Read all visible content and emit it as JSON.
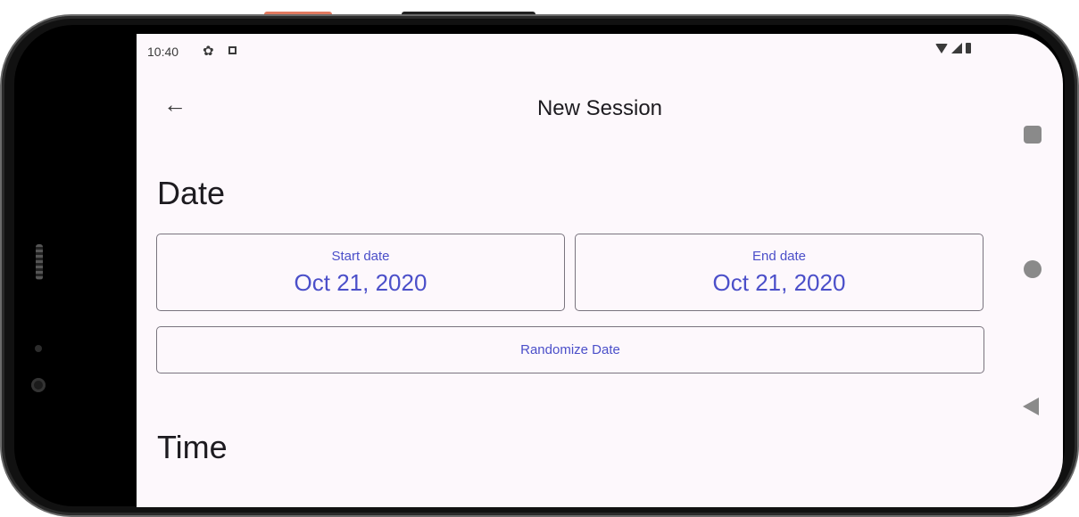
{
  "status_bar": {
    "time": "10:40",
    "icons": [
      "gear-icon",
      "notification-icon",
      "wifi-icon",
      "signal-icon",
      "battery-icon"
    ]
  },
  "app_bar": {
    "back_icon": "←",
    "title": "New Session"
  },
  "date_section": {
    "title": "Date",
    "start": {
      "label": "Start date",
      "value": "Oct 21, 2020"
    },
    "end": {
      "label": "End date",
      "value": "Oct 21, 2020"
    },
    "randomize_label": "Randomize Date"
  },
  "time_section": {
    "title": "Time"
  },
  "colors": {
    "accent": "#4b4fc9",
    "screen_background": "#fdf8fc",
    "outline": "#79747e"
  }
}
